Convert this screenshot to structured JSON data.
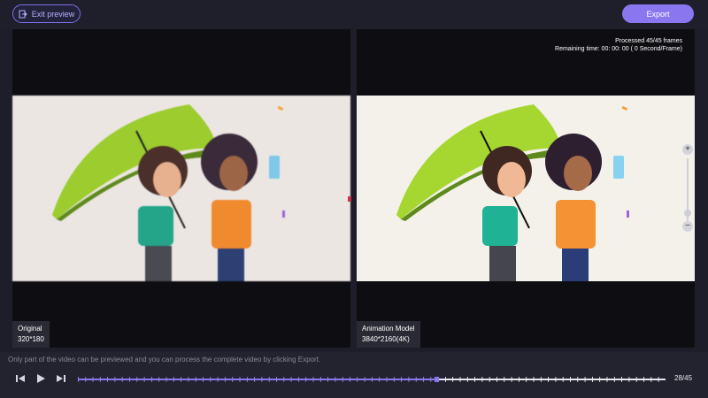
{
  "toolbar": {
    "exit_label": "Exit preview",
    "export_label": "Export"
  },
  "status": {
    "processed": "Processed 45/45 frames",
    "remaining": "Remaining time: 00: 00: 00 ( 0 Second/Frame)"
  },
  "panels": {
    "original": {
      "title": "Original",
      "resolution": "320*180"
    },
    "enhanced": {
      "title": "Animation Model",
      "resolution": "3840*2160(4K)"
    }
  },
  "zoom": {
    "plus": "+",
    "minus": "−"
  },
  "footer": {
    "hint": "Only part of the video can be previewed and you can process the complete video by clicking Export.",
    "frame_counter": "28/45",
    "progress_fraction": 0.61
  },
  "colors": {
    "accent": "#8a77f0",
    "umbrella": "#9ccc2e",
    "orange_top": "#f08a2e",
    "jeans": "#2d3f73"
  },
  "icons": {
    "exit": "exit-icon",
    "prev": "step-back-icon",
    "play": "play-icon",
    "next": "step-forward-icon"
  }
}
